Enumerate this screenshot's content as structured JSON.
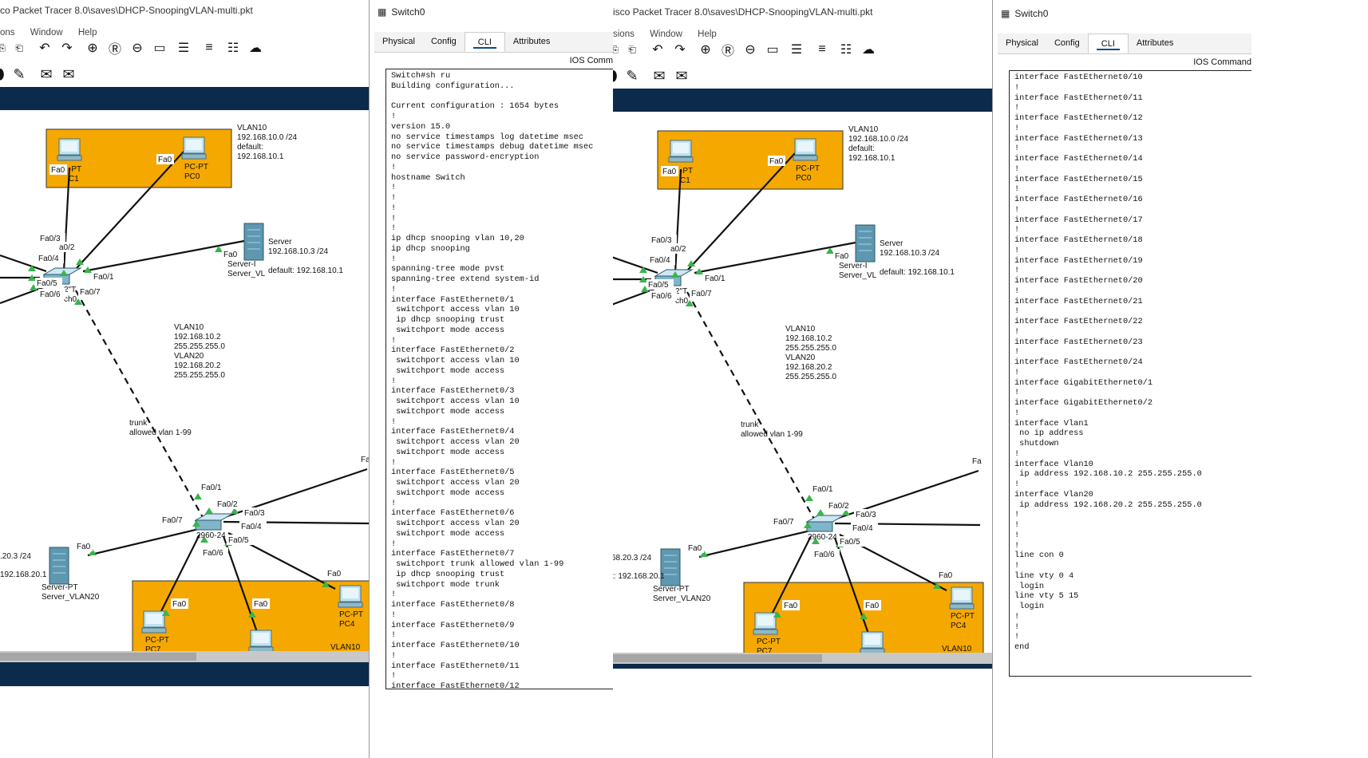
{
  "left_pt": {
    "title": "co Packet Tracer 8.0\\saves\\DHCP-SnoopingVLAN-multi.pkt",
    "menu": [
      "ons",
      "Window",
      "Help"
    ]
  },
  "right_pt": {
    "title": "isco Packet Tracer 8.0\\saves\\DHCP-SnoopingVLAN-multi.pkt",
    "menu": [
      "sions",
      "Window",
      "Help"
    ]
  },
  "left_cli": {
    "window_title": "Switch0",
    "tabs": [
      "Physical",
      "Config",
      "CLI",
      "Attributes"
    ],
    "active_tab": "CLI",
    "header": "IOS Comm"
  },
  "right_cli": {
    "window_title": "Switch0",
    "tabs": [
      "Physical",
      "Config",
      "CLI",
      "Attributes"
    ],
    "active_tab": "CLI",
    "header": "IOS Command"
  },
  "topology": {
    "vlan10_box_label": "VLAN10\n192.168.10.0 /24\n\ndefault:\n192.168.10.1",
    "vlan10_bottom_label": "VLAN10",
    "server_label": "Server\n192.168.10.3 /24",
    "server_default": "default: 192.168.10.1",
    "server_name": "Server-I\nServer_VL",
    "svi_label": "VLAN10\n192.168.10.2\n255.255.255.0\n\nVLAN20\n192.168.20.2\n255.255.255.0",
    "trunk_label": "trunk\nallowed vlan 1-99",
    "server2_ip_left": ".20.3 /24",
    "server2_ip_right": "68.20.3 /24",
    "server2_default_left": "192.168.20.1",
    "server2_default_right": "t: 192.168.20.1",
    "server2_name": "Server-PT\nServer_VLAN20",
    "pc1_label": "-PT\nC1",
    "pc0_label": "PC-PT\nPC0",
    "pc4_label": "PC-PT\nPC4",
    "pc7_label": "PC-PT\nPC7",
    "sw0_label": "2\"T\nch0",
    "sw1_label": "2960-24",
    "ports": {
      "fa0": "Fa0",
      "fa0_1": "Fa0/1",
      "fa0_2": "Fa0/2",
      "fa0_3": "Fa0/3",
      "fa0_4": "Fa0/4",
      "fa0_5": "Fa0/5",
      "fa0_6": "Fa0/6",
      "fa0_7": "Fa0/7",
      "a0_2": "a0/2",
      "fa": "Fa"
    }
  },
  "left_console": [
    "Switch#sh ru",
    "Building configuration...",
    "",
    "Current configuration : 1654 bytes",
    "!",
    "version 15.0",
    "no service timestamps log datetime msec",
    "no service timestamps debug datetime msec",
    "no service password-encryption",
    "!",
    "hostname Switch",
    "!",
    "!",
    "!",
    "!",
    "!",
    "ip dhcp snooping vlan 10,20",
    "ip dhcp snooping",
    "!",
    "spanning-tree mode pvst",
    "spanning-tree extend system-id",
    "!",
    "interface FastEthernet0/1",
    " switchport access vlan 10",
    " ip dhcp snooping trust",
    " switchport mode access",
    "!",
    "interface FastEthernet0/2",
    " switchport access vlan 10",
    " switchport mode access",
    "!",
    "interface FastEthernet0/3",
    " switchport access vlan 10",
    " switchport mode access",
    "!",
    "interface FastEthernet0/4",
    " switchport access vlan 20",
    " switchport mode access",
    "!",
    "interface FastEthernet0/5",
    " switchport access vlan 20",
    " switchport mode access",
    "!",
    "interface FastEthernet0/6",
    " switchport access vlan 20",
    " switchport mode access",
    "!",
    "interface FastEthernet0/7",
    " switchport trunk allowed vlan 1-99",
    " ip dhcp snooping trust",
    " switchport mode trunk",
    "!",
    "interface FastEthernet0/8",
    "!",
    "interface FastEthernet0/9",
    "!",
    "interface FastEthernet0/10",
    "!",
    "interface FastEthernet0/11",
    "!",
    "interface FastEthernet0/12"
  ],
  "right_console": [
    "interface FastEthernet0/10",
    "!",
    "interface FastEthernet0/11",
    "!",
    "interface FastEthernet0/12",
    "!",
    "interface FastEthernet0/13",
    "!",
    "interface FastEthernet0/14",
    "!",
    "interface FastEthernet0/15",
    "!",
    "interface FastEthernet0/16",
    "!",
    "interface FastEthernet0/17",
    "!",
    "interface FastEthernet0/18",
    "!",
    "interface FastEthernet0/19",
    "!",
    "interface FastEthernet0/20",
    "!",
    "interface FastEthernet0/21",
    "!",
    "interface FastEthernet0/22",
    "!",
    "interface FastEthernet0/23",
    "!",
    "interface FastEthernet0/24",
    "!",
    "interface GigabitEthernet0/1",
    "!",
    "interface GigabitEthernet0/2",
    "!",
    "interface Vlan1",
    " no ip address",
    " shutdown",
    "!",
    "interface Vlan10",
    " ip address 192.168.10.2 255.255.255.0",
    "!",
    "interface Vlan20",
    " ip address 192.168.20.2 255.255.255.0",
    "!",
    "!",
    "!",
    "!",
    "line con 0",
    "!",
    "line vty 0 4",
    " login",
    "line vty 5 15",
    " login",
    "!",
    "!",
    "!",
    "end"
  ],
  "colors": {
    "vlan_box": "#f5a800",
    "link": "#111111",
    "port_arrow": "#39b54a",
    "titlebar": "#0c2a4b"
  },
  "icons": [
    "undo-icon",
    "redo-icon",
    "zoom-in-icon",
    "zoom-reset-icon",
    "zoom-out-icon",
    "fit-icon",
    "palette-icon",
    "notes-icon",
    "network-icon",
    "cloud-icon",
    "ellipse-icon",
    "freeform-icon",
    "envelope-icon",
    "open-envelope-icon"
  ]
}
